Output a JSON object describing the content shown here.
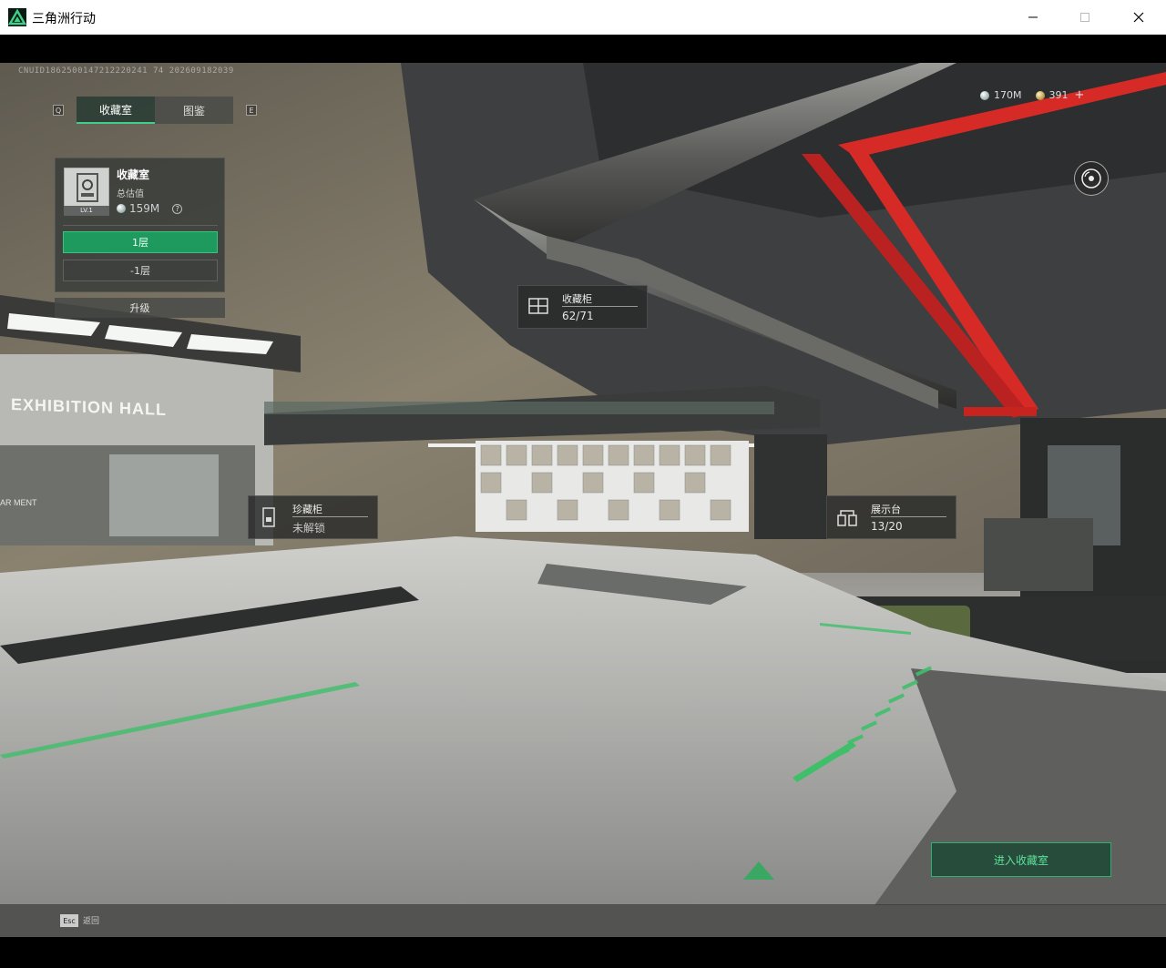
{
  "window": {
    "title": "三角洲行动"
  },
  "hud": {
    "uid": "CNUID1862500147212220241 74 202609182039",
    "tabs": {
      "left_key": "Q",
      "right_key": "E",
      "items": [
        {
          "label": "收藏室",
          "active": true
        },
        {
          "label": "图鉴",
          "active": false
        }
      ]
    },
    "collection_panel": {
      "title": "收藏室",
      "level": "LV.1",
      "estimate_label": "总估值",
      "estimate_value": "159M",
      "help": "?",
      "floors": [
        "1层",
        "-1层"
      ],
      "active_floor": "1层",
      "upgrade_label": "升级"
    },
    "currency": [
      {
        "icon": "silver-coin-icon",
        "value": "170M"
      },
      {
        "icon": "gold-coin-icon",
        "value": "391"
      }
    ],
    "currency_add": "+",
    "world_labels": {
      "cabinet": {
        "name": "收藏柜",
        "value": "62/71"
      },
      "treasure": {
        "name": "珍藏柜",
        "value": "未解锁"
      },
      "display": {
        "name": "展示台",
        "value": "13/20"
      }
    },
    "scene_text": {
      "hall_sign": "EXHIBITION HALL",
      "armament_sign": "AR MENT"
    },
    "enter_button": "进入收藏室",
    "esc_key": "Esc",
    "esc_label": "返回"
  },
  "colors": {
    "accent": "#3fcf88",
    "pipe_red": "#d62a26"
  }
}
